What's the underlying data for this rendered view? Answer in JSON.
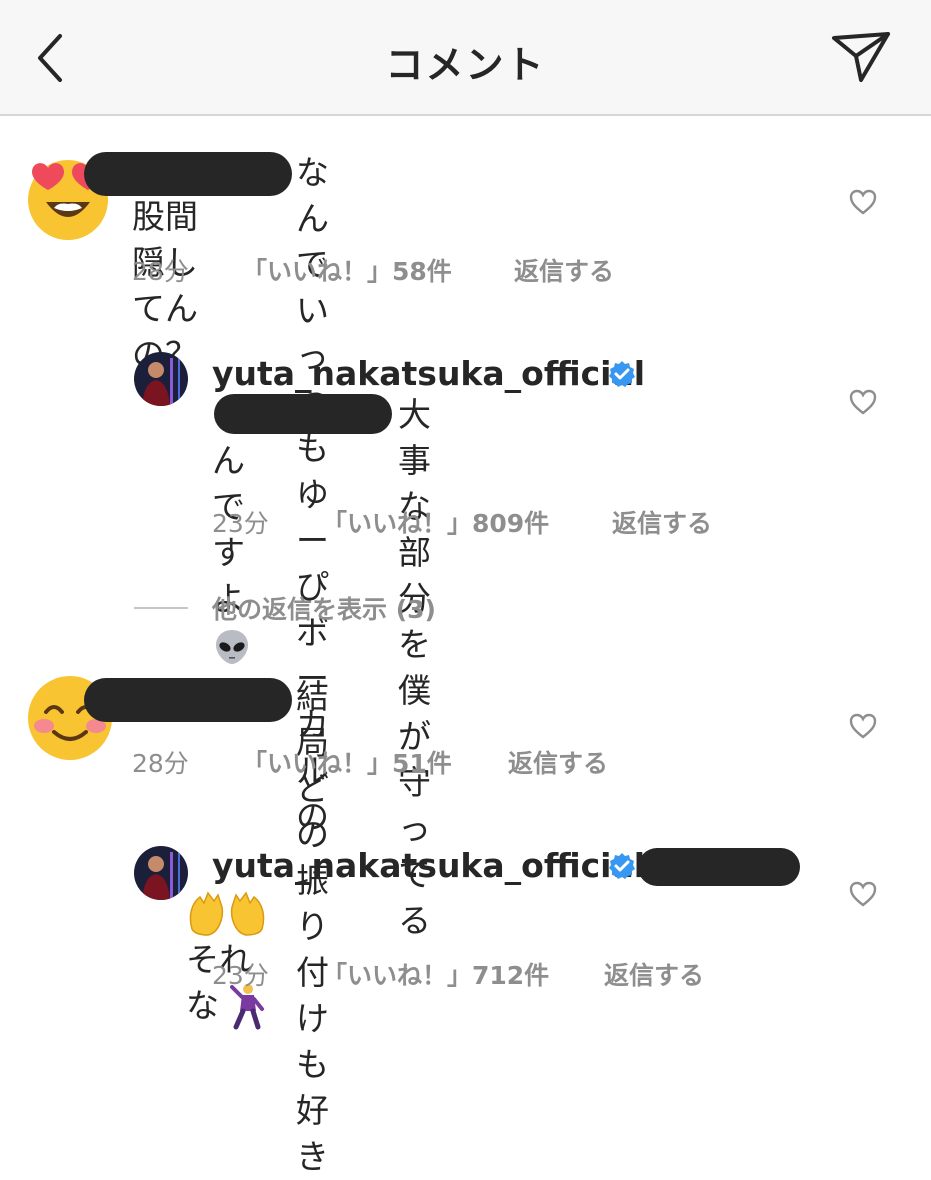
{
  "header": {
    "title": "コメント"
  },
  "comments": [
    {
      "text_line1": "なんでいっつもゆーぴボーカルの",
      "text_line2": "股間隠してんの？",
      "time": "28分",
      "likes": "「いいね！」58件",
      "reply": "返信する",
      "avatar_icon": "heart-eyes-emoji-icon"
    },
    {
      "username": "yuta_nakatsuka_official",
      "text_line1": "大事な部分を僕が守ってる",
      "text_line2": "んですよ",
      "time": "23分",
      "likes": "「いいね！」809件",
      "reply": "返信する",
      "emoji_icon": "alien-emoji-icon"
    },
    {
      "text_line1": "結局どの振り付けも好き",
      "time": "28分",
      "likes": "「いいね！」51件",
      "reply": "返信する",
      "avatar_icon": "blushing-smile-emoji-icon"
    },
    {
      "username": "yuta_nakatsuka_official",
      "text_line1": "それな",
      "time": "23分",
      "likes": "「いいね！」712件",
      "reply": "返信する",
      "emoji_icons": [
        "raising-hands-emoji-icon",
        "dancing-man-emoji-icon"
      ]
    }
  ],
  "view_replies": "他の返信を表示 (3)",
  "colors": {
    "text": "#262626",
    "muted": "#8e8e8e",
    "verified": "#3897f0",
    "header_bg": "#f7f7f7"
  }
}
